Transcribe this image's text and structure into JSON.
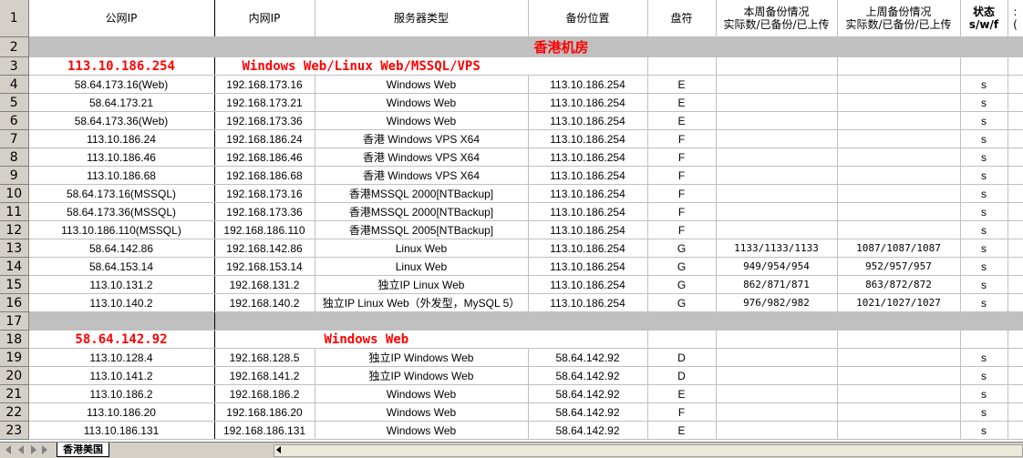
{
  "headers": {
    "row_num": "1",
    "public_ip": "公网IP",
    "private_ip": "内网IP",
    "server_type": "服务器类型",
    "backup_location": "备份位置",
    "drive": "盘符",
    "this_week": "本周备份情况\n实际数/已备份/已上传",
    "last_week": "上周备份情况\n实际数/已备份/已上传",
    "status": "状态\ns/w/f",
    "extra": ": ("
  },
  "bands": {
    "row2": {
      "num": "2",
      "label": "香港机房"
    },
    "row17": {
      "num": "17"
    }
  },
  "groups": {
    "g1": {
      "num": "3",
      "ip": "113.10.186.254",
      "type": "Windows Web/Linux Web/MSSQL/VPS"
    },
    "g2": {
      "num": "18",
      "ip": "58.64.142.92",
      "type": "Windows Web"
    }
  },
  "rows_a": [
    {
      "num": "4",
      "pub": "58.64.173.16(Web)",
      "priv": "192.168.173.16",
      "type": "Windows Web",
      "loc": "113.10.186.254",
      "drive": "E",
      "tw": "",
      "lw": "",
      "st": "s"
    },
    {
      "num": "5",
      "pub": "58.64.173.21",
      "priv": "192.168.173.21",
      "type": "Windows Web",
      "loc": "113.10.186.254",
      "drive": "E",
      "tw": "",
      "lw": "",
      "st": "s"
    },
    {
      "num": "6",
      "pub": "58.64.173.36(Web)",
      "priv": "192.168.173.36",
      "type": "Windows Web",
      "loc": "113.10.186.254",
      "drive": "E",
      "tw": "",
      "lw": "",
      "st": "s"
    },
    {
      "num": "7",
      "pub": "113.10.186.24",
      "priv": "192.168.186.24",
      "type": "香港 Windows VPS X64",
      "loc": "113.10.186.254",
      "drive": "F",
      "tw": "",
      "lw": "",
      "st": "s"
    },
    {
      "num": "8",
      "pub": "113.10.186.46",
      "priv": "192.168.186.46",
      "type": "香港 Windows VPS X64",
      "loc": "113.10.186.254",
      "drive": "F",
      "tw": "",
      "lw": "",
      "st": "s"
    },
    {
      "num": "9",
      "pub": "113.10.186.68",
      "priv": "192.168.186.68",
      "type": "香港 Windows VPS X64",
      "loc": "113.10.186.254",
      "drive": "F",
      "tw": "",
      "lw": "",
      "st": "s"
    },
    {
      "num": "10",
      "pub": "58.64.173.16(MSSQL)",
      "priv": "192.168.173.16",
      "type": "香港MSSQL 2000[NTBackup]",
      "loc": "113.10.186.254",
      "drive": "F",
      "tw": "",
      "lw": "",
      "st": "s"
    },
    {
      "num": "11",
      "pub": "58.64.173.36(MSSQL)",
      "priv": "192.168.173.36",
      "type": "香港MSSQL 2000[NTBackup]",
      "loc": "113.10.186.254",
      "drive": "F",
      "tw": "",
      "lw": "",
      "st": "s"
    },
    {
      "num": "12",
      "pub": "113.10.186.110(MSSQL)",
      "priv": "192.168.186.110",
      "type": "香港MSSQL 2005[NTBackup]",
      "loc": "113.10.186.254",
      "drive": "F",
      "tw": "",
      "lw": "",
      "st": "s"
    },
    {
      "num": "13",
      "pub": "58.64.142.86",
      "priv": "192.168.142.86",
      "type": "Linux Web",
      "loc": "113.10.186.254",
      "drive": "G",
      "tw": "1133/1133/1133",
      "lw": "1087/1087/1087",
      "st": "s"
    },
    {
      "num": "14",
      "pub": "58.64.153.14",
      "priv": "192.168.153.14",
      "type": "Linux Web",
      "loc": "113.10.186.254",
      "drive": "G",
      "tw": "949/954/954",
      "lw": "952/957/957",
      "st": "s"
    },
    {
      "num": "15",
      "pub": "113.10.131.2",
      "priv": "192.168.131.2",
      "type": "独立IP Linux Web",
      "loc": "113.10.186.254",
      "drive": "G",
      "tw": "862/871/871",
      "lw": "863/872/872",
      "st": "s"
    },
    {
      "num": "16",
      "pub": "113.10.140.2",
      "priv": "192.168.140.2",
      "type": "独立IP Linux Web（外发型，MySQL 5）",
      "loc": "113.10.186.254",
      "drive": "G",
      "tw": "976/982/982",
      "lw": "1021/1027/1027",
      "st": "s"
    }
  ],
  "rows_b": [
    {
      "num": "19",
      "pub": "113.10.128.4",
      "priv": "192.168.128.5",
      "type": "独立IP Windows Web",
      "loc": "58.64.142.92",
      "drive": "D",
      "tw": "",
      "lw": "",
      "st": "s"
    },
    {
      "num": "20",
      "pub": "113.10.141.2",
      "priv": "192.168.141.2",
      "type": "独立IP Windows Web",
      "loc": "58.64.142.92",
      "drive": "D",
      "tw": "",
      "lw": "",
      "st": "s"
    },
    {
      "num": "21",
      "pub": "113.10.186.2",
      "priv": "192.168.186.2",
      "type": "Windows Web",
      "loc": "58.64.142.92",
      "drive": "E",
      "tw": "",
      "lw": "",
      "st": "s"
    },
    {
      "num": "22",
      "pub": "113.10.186.20",
      "priv": "192.168.186.20",
      "type": "Windows Web",
      "loc": "58.64.142.92",
      "drive": "F",
      "tw": "",
      "lw": "",
      "st": "s"
    },
    {
      "num": "23",
      "pub": "113.10.186.131",
      "priv": "192.168.186.131",
      "type": "Windows Web",
      "loc": "58.64.142.92",
      "drive": "E",
      "tw": "",
      "lw": "",
      "st": "s"
    }
  ],
  "sheet_tab": "香港美国"
}
